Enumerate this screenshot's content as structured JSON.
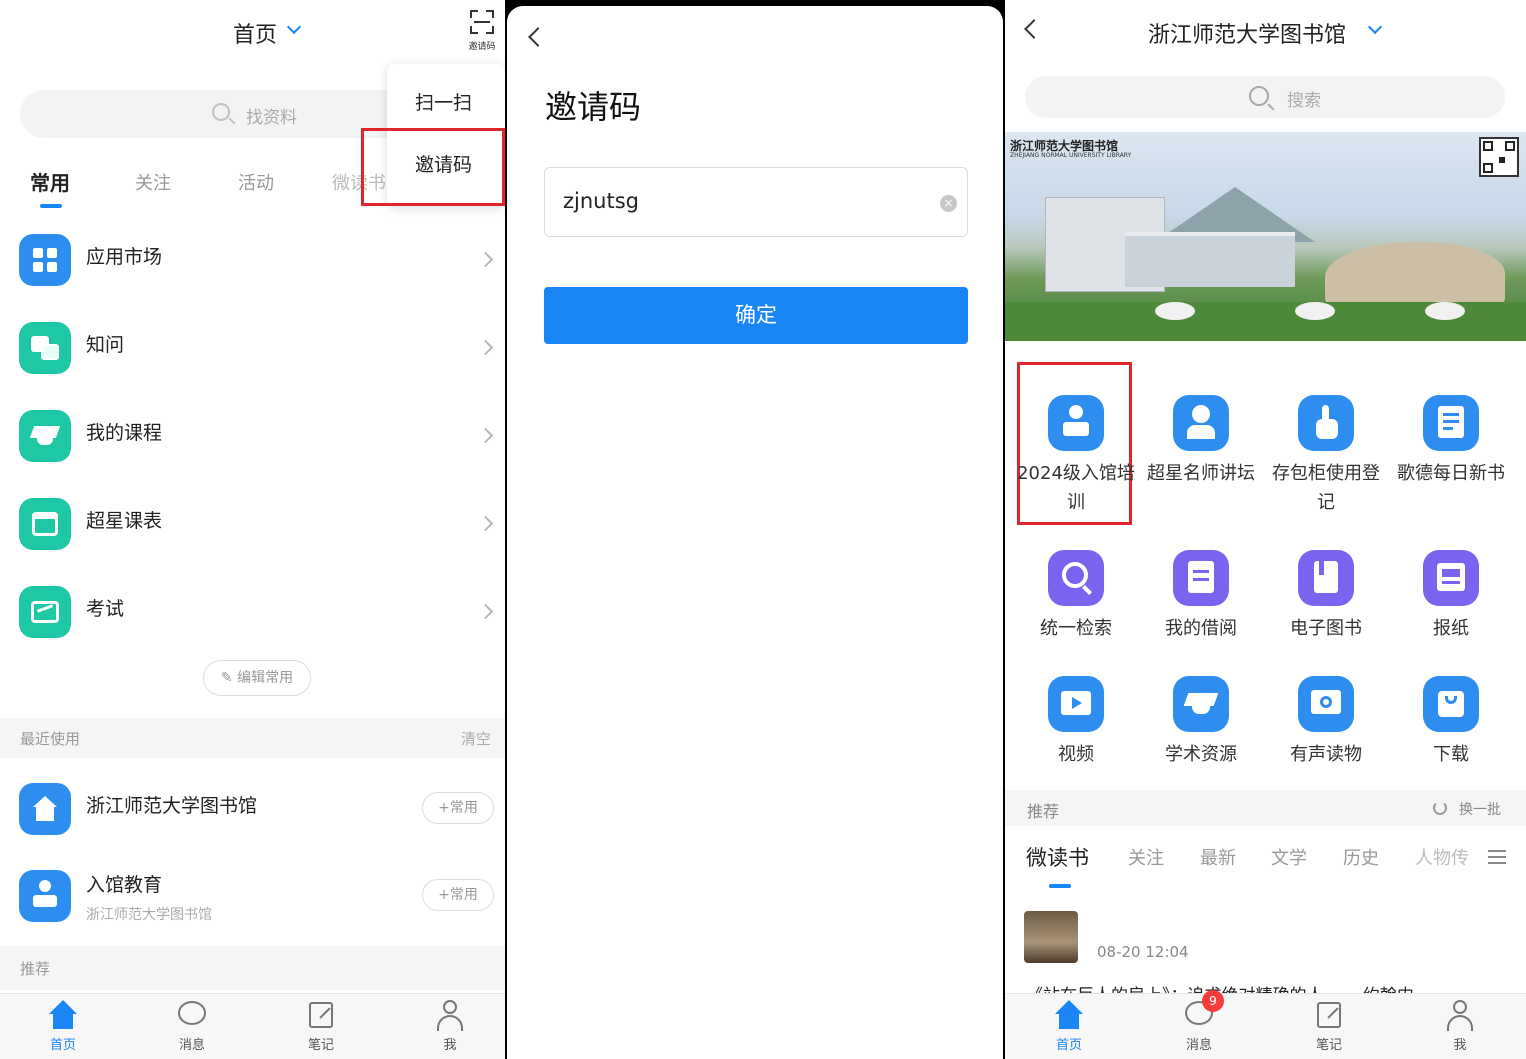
{
  "panel1": {
    "header_title": "首页",
    "scan_label": "邀请码",
    "search_placeholder": "找资料",
    "tabs": [
      "常用",
      "关注",
      "活动",
      "微读书"
    ],
    "popup": {
      "scan": "扫一扫",
      "invite": "邀请码"
    },
    "items": [
      {
        "label": "应用市场"
      },
      {
        "label": "知问"
      },
      {
        "label": "我的课程"
      },
      {
        "label": "超星课表"
      },
      {
        "label": "考试"
      }
    ],
    "edit_common": "编辑常用",
    "recent_header": "最近使用",
    "clear": "清空",
    "recent": [
      {
        "title": "浙江师范大学图书馆",
        "subtitle": "",
        "add": "+常用"
      },
      {
        "title": "入馆教育",
        "subtitle": "浙江师范大学图书馆",
        "add": "+常用"
      }
    ],
    "recommend_header": "推荐",
    "tabbar": [
      "首页",
      "消息",
      "笔记",
      "我"
    ]
  },
  "panel2": {
    "title": "邀请码",
    "input_value": "zjnutsg",
    "confirm": "确定"
  },
  "panel3": {
    "header_title": "浙江师范大学图书馆",
    "search_placeholder": "搜索",
    "banner_logo": "浙江师范大学图书馆",
    "banner_logo_en": "ZHEJIANG NORMAL UNIVERSITY LIBRARY",
    "grid": [
      {
        "label": "2024级入馆培训",
        "icon": "person-podium-icon"
      },
      {
        "label": "超星名师讲坛",
        "icon": "teacher-icon"
      },
      {
        "label": "存包柜使用登记",
        "icon": "hand-pointer-icon"
      },
      {
        "label": "歌德每日新书",
        "icon": "book-list-icon"
      },
      {
        "label": "统一检索",
        "icon": "search-icon"
      },
      {
        "label": "我的借阅",
        "icon": "clipboard-icon"
      },
      {
        "label": "电子图书",
        "icon": "ebook-icon"
      },
      {
        "label": "报纸",
        "icon": "newspaper-icon"
      },
      {
        "label": "视频",
        "icon": "video-icon"
      },
      {
        "label": "学术资源",
        "icon": "graduation-cap-icon"
      },
      {
        "label": "有声读物",
        "icon": "audio-icon"
      },
      {
        "label": "下载",
        "icon": "download-icon"
      }
    ],
    "recommend_header": "推荐",
    "refresh": "换一批",
    "cat_tabs": [
      "微读书",
      "关注",
      "最新",
      "文学",
      "历史",
      "人物传"
    ],
    "feed_date": "08-20 12:04",
    "feed_title": "《站在巨人的肩上》：追求绝对精确的人  ……约翰内",
    "tabbar": [
      "首页",
      "消息",
      "笔记",
      "我"
    ],
    "badge": "9"
  },
  "colors": {
    "accent": "#1a86f5",
    "highlight": "#e0262b",
    "teal": "#1ec8a5"
  }
}
